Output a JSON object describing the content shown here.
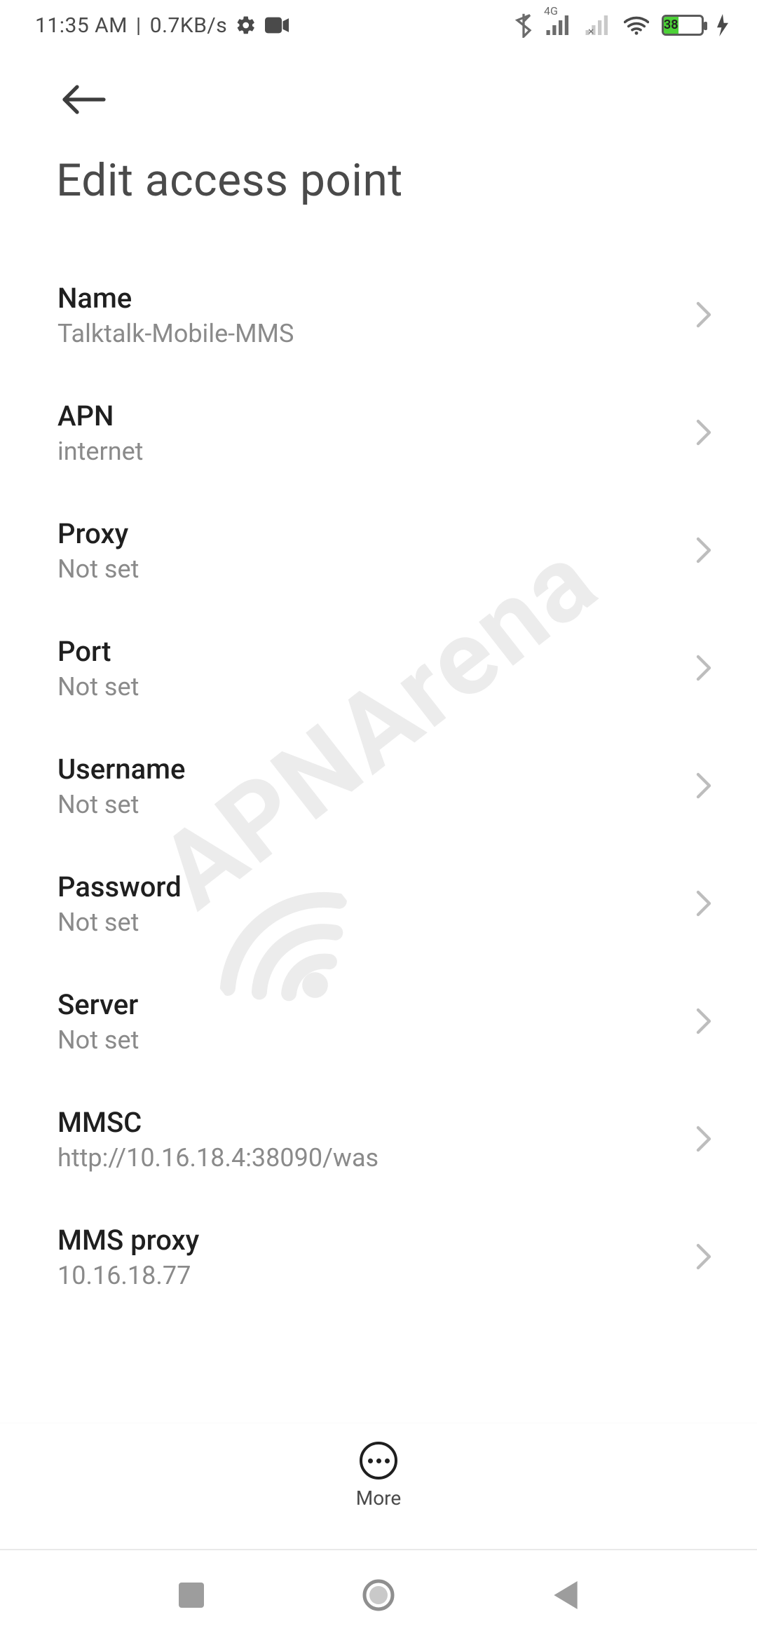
{
  "status": {
    "time": "11:35 AM",
    "sep": " | ",
    "net_speed": "0.7KB/s",
    "network_label": "4G",
    "battery_percent": 38,
    "battery_text": "38"
  },
  "header": {
    "title": "Edit access point"
  },
  "fields": [
    {
      "key": "name",
      "label": "Name",
      "value": "Talktalk-Mobile-MMS"
    },
    {
      "key": "apn",
      "label": "APN",
      "value": "internet"
    },
    {
      "key": "proxy",
      "label": "Proxy",
      "value": "Not set"
    },
    {
      "key": "port",
      "label": "Port",
      "value": "Not set"
    },
    {
      "key": "username",
      "label": "Username",
      "value": "Not set"
    },
    {
      "key": "password",
      "label": "Password",
      "value": "Not set"
    },
    {
      "key": "server",
      "label": "Server",
      "value": "Not set"
    },
    {
      "key": "mmsc",
      "label": "MMSC",
      "value": "http://10.16.18.4:38090/was"
    },
    {
      "key": "mms_proxy",
      "label": "MMS proxy",
      "value": "10.16.18.77"
    }
  ],
  "overflow": {
    "label": "More"
  },
  "watermark": "APNArena"
}
